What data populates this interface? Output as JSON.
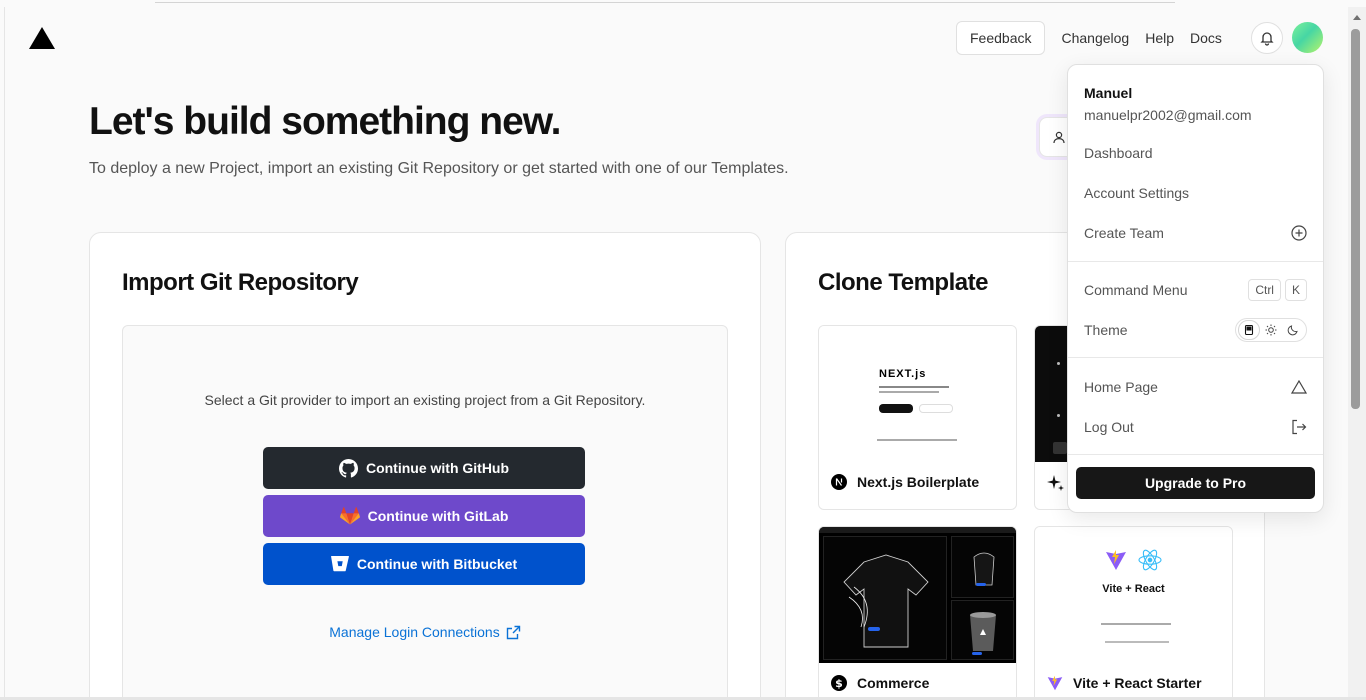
{
  "nav": {
    "feedback": "Feedback",
    "changelog": "Changelog",
    "help": "Help",
    "docs": "Docs"
  },
  "hero": {
    "title": "Let's build something new.",
    "subtitle": "To deploy a new Project, import an existing Git Repository or get started with one of our Templates."
  },
  "import": {
    "title": "Import Git Repository",
    "prompt": "Select a Git provider to import an existing project from a Git Repository.",
    "github": "Continue with GitHub",
    "gitlab": "Continue with GitLab",
    "bitbucket": "Continue with Bitbucket",
    "manage": "Manage Login Connections"
  },
  "clone": {
    "title": "Clone Template",
    "templates": [
      {
        "label": "Next.js Boilerplate",
        "preview_brand": "NEXT.js"
      },
      {
        "label": ""
      },
      {
        "label": "Commerce"
      },
      {
        "label": "Vite + React Starter",
        "preview_title": "Vite + React"
      }
    ]
  },
  "menu": {
    "name": "Manuel",
    "email": "manuelpr2002@gmail.com",
    "dashboard": "Dashboard",
    "account_settings": "Account Settings",
    "create_team": "Create Team",
    "command_menu": "Command Menu",
    "kbd_ctrl": "Ctrl",
    "kbd_k": "K",
    "theme": "Theme",
    "home_page": "Home Page",
    "log_out": "Log Out",
    "upgrade": "Upgrade to Pro"
  },
  "colors": {
    "github": "#24292f",
    "gitlab": "#6e49cb",
    "bitbucket": "#0052cc",
    "link": "#0a72d6",
    "upgrade": "#171717"
  }
}
